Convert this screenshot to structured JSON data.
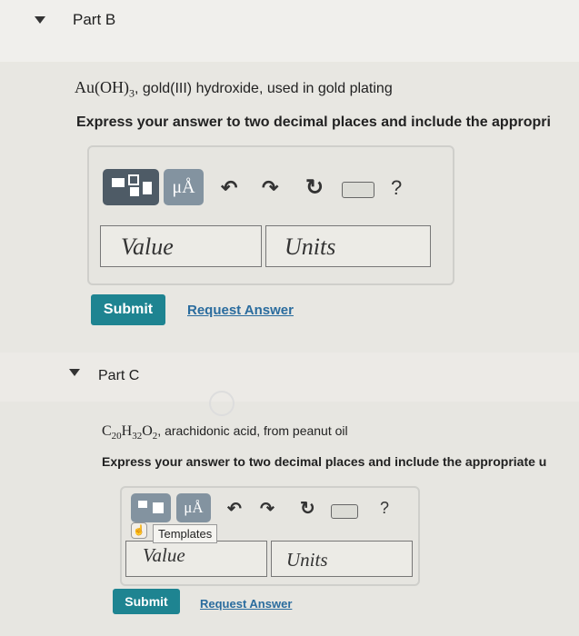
{
  "partB": {
    "title": "Part B",
    "formula": "Au(OH)",
    "subscript": "3",
    "description": ", gold(III) hydroxide, used in gold plating",
    "prompt": "Express your answer to two decimal places and include the appropri",
    "toolbar": {
      "mu_label": "μÅ",
      "help": "?"
    },
    "value_placeholder": "Value",
    "units_placeholder": "Units",
    "submit_label": "Submit",
    "request_label": "Request Answer"
  },
  "partC": {
    "title": "Part C",
    "formula_parts": [
      "C",
      "20",
      "H",
      "32",
      "O",
      "2"
    ],
    "description": ", arachidonic acid, from peanut oil",
    "prompt": "Express your answer to two decimal places and include the appropriate u",
    "toolbar": {
      "mu_label": "μÅ",
      "help": "?"
    },
    "tooltip": "Templates",
    "value_placeholder": "Value",
    "units_placeholder": "Units",
    "submit_label": "Submit",
    "request_label": "Request Answer"
  }
}
